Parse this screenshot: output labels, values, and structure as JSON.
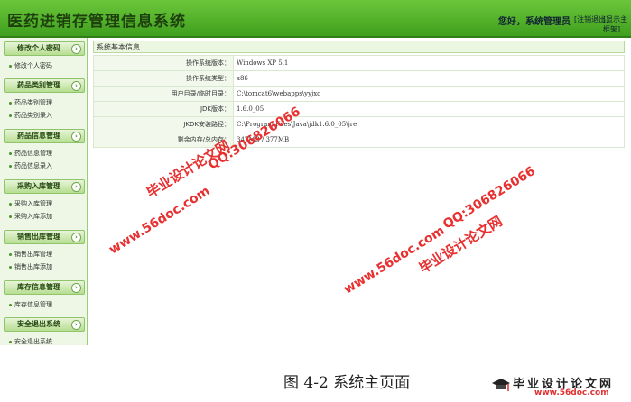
{
  "header": {
    "title": "医药进销存管理信息系统",
    "greeting": "您好，",
    "user_role": "系统管理员",
    "logout_label": "[注销退出]",
    "sysinfo_label": "[显示主框架]"
  },
  "sidebar": {
    "sections": [
      {
        "title": "修改个人密码",
        "items": [
          "修改个人密码"
        ]
      },
      {
        "title": "药品类别管理",
        "items": [
          "药品类别管理",
          "药品类别录入"
        ]
      },
      {
        "title": "药品信息管理",
        "items": [
          "药品信息管理",
          "药品信息录入"
        ]
      },
      {
        "title": "采购入库管理",
        "items": [
          "采购入库管理",
          "采购入库添加"
        ]
      },
      {
        "title": "销售出库管理",
        "items": [
          "销售出库管理",
          "销售出库添加"
        ]
      },
      {
        "title": "库存信息管理",
        "items": [
          "库存信息管理"
        ]
      },
      {
        "title": "安全退出系统",
        "items": [
          "安全退出系统"
        ]
      }
    ]
  },
  "main": {
    "panel_title": "系统基本信息",
    "rows": [
      {
        "label": "操作系统版本：",
        "value": "Windows XP  5.1"
      },
      {
        "label": "操作系统类型：",
        "value": "x86"
      },
      {
        "label": "用户目录/临时目录：",
        "value": "C:\\tomcat6\\webapps\\yyjxc"
      },
      {
        "label": "JDK版本：",
        "value": "1.6.0_05"
      },
      {
        "label": "JKDK安装路径：",
        "value": "C:\\Program Files\\Java\\jdk1.6.0_05\\jre"
      },
      {
        "label": "剩余内存/总内存：",
        "value": "347MB / 377MB"
      }
    ]
  },
  "watermarks": {
    "url": "www.56doc.com",
    "qq": "QQ:306826066",
    "brand": "毕业设计论文网"
  },
  "caption": "图 4-2 系统主页面",
  "footer_logo": {
    "brand": "毕业设计论文网",
    "url": "www.56doc.com"
  }
}
